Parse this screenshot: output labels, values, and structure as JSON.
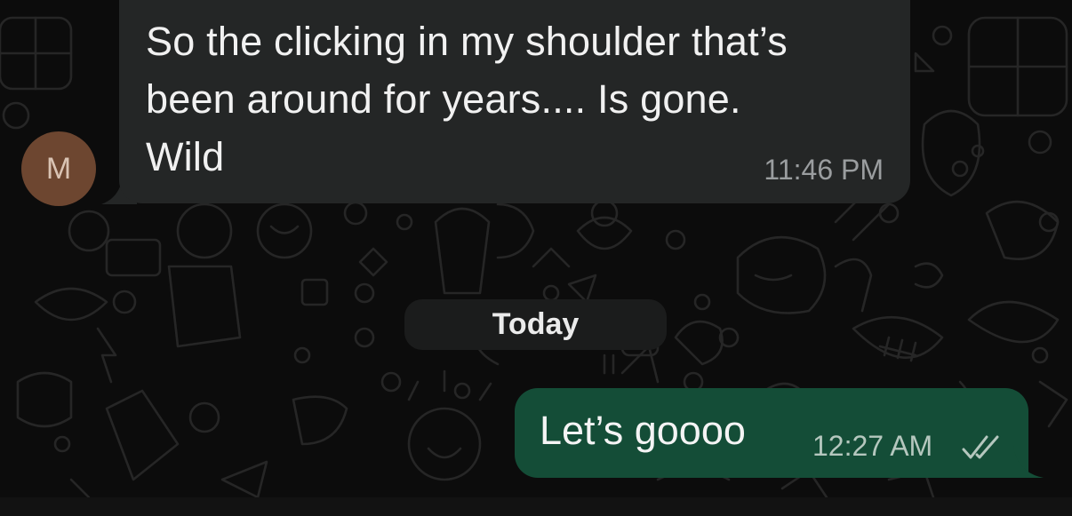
{
  "incoming": {
    "avatar_initial": "M",
    "message_line1": "So the clicking in my shoulder that’s",
    "message_line2": "been around for years.... Is gone.",
    "message_line3": "Wild",
    "time": "11:46 PM"
  },
  "date_divider": "Today",
  "outgoing": {
    "message": "Let’s goooo",
    "time": "12:27 AM",
    "status_icon": "double-check-read"
  },
  "colors": {
    "background": "#0c0c0c",
    "incoming_bubble": "#242626",
    "outgoing_bubble": "#144d37",
    "avatar": "#6d4630"
  }
}
